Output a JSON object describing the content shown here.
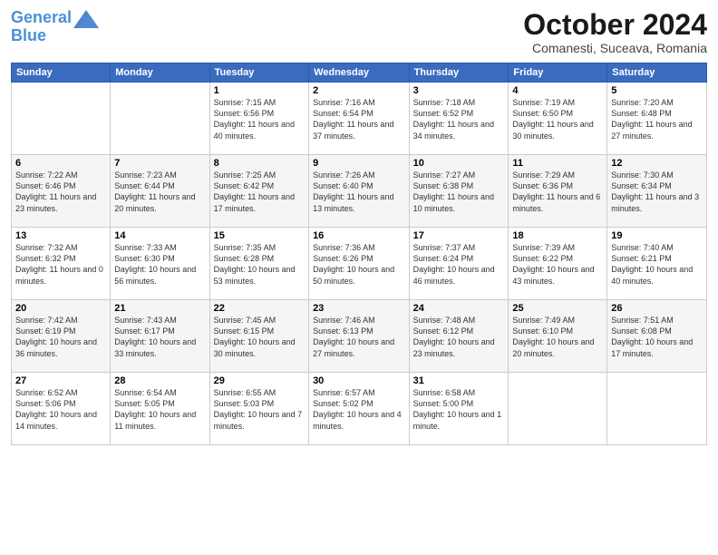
{
  "logo": {
    "line1": "General",
    "line2": "Blue"
  },
  "title": "October 2024",
  "subtitle": "Comanesti, Suceava, Romania",
  "weekdays": [
    "Sunday",
    "Monday",
    "Tuesday",
    "Wednesday",
    "Thursday",
    "Friday",
    "Saturday"
  ],
  "weeks": [
    [
      {
        "day": "",
        "detail": ""
      },
      {
        "day": "",
        "detail": ""
      },
      {
        "day": "1",
        "detail": "Sunrise: 7:15 AM\nSunset: 6:56 PM\nDaylight: 11 hours\nand 40 minutes."
      },
      {
        "day": "2",
        "detail": "Sunrise: 7:16 AM\nSunset: 6:54 PM\nDaylight: 11 hours\nand 37 minutes."
      },
      {
        "day": "3",
        "detail": "Sunrise: 7:18 AM\nSunset: 6:52 PM\nDaylight: 11 hours\nand 34 minutes."
      },
      {
        "day": "4",
        "detail": "Sunrise: 7:19 AM\nSunset: 6:50 PM\nDaylight: 11 hours\nand 30 minutes."
      },
      {
        "day": "5",
        "detail": "Sunrise: 7:20 AM\nSunset: 6:48 PM\nDaylight: 11 hours\nand 27 minutes."
      }
    ],
    [
      {
        "day": "6",
        "detail": "Sunrise: 7:22 AM\nSunset: 6:46 PM\nDaylight: 11 hours\nand 23 minutes."
      },
      {
        "day": "7",
        "detail": "Sunrise: 7:23 AM\nSunset: 6:44 PM\nDaylight: 11 hours\nand 20 minutes."
      },
      {
        "day": "8",
        "detail": "Sunrise: 7:25 AM\nSunset: 6:42 PM\nDaylight: 11 hours\nand 17 minutes."
      },
      {
        "day": "9",
        "detail": "Sunrise: 7:26 AM\nSunset: 6:40 PM\nDaylight: 11 hours\nand 13 minutes."
      },
      {
        "day": "10",
        "detail": "Sunrise: 7:27 AM\nSunset: 6:38 PM\nDaylight: 11 hours\nand 10 minutes."
      },
      {
        "day": "11",
        "detail": "Sunrise: 7:29 AM\nSunset: 6:36 PM\nDaylight: 11 hours\nand 6 minutes."
      },
      {
        "day": "12",
        "detail": "Sunrise: 7:30 AM\nSunset: 6:34 PM\nDaylight: 11 hours\nand 3 minutes."
      }
    ],
    [
      {
        "day": "13",
        "detail": "Sunrise: 7:32 AM\nSunset: 6:32 PM\nDaylight: 11 hours\nand 0 minutes."
      },
      {
        "day": "14",
        "detail": "Sunrise: 7:33 AM\nSunset: 6:30 PM\nDaylight: 10 hours\nand 56 minutes."
      },
      {
        "day": "15",
        "detail": "Sunrise: 7:35 AM\nSunset: 6:28 PM\nDaylight: 10 hours\nand 53 minutes."
      },
      {
        "day": "16",
        "detail": "Sunrise: 7:36 AM\nSunset: 6:26 PM\nDaylight: 10 hours\nand 50 minutes."
      },
      {
        "day": "17",
        "detail": "Sunrise: 7:37 AM\nSunset: 6:24 PM\nDaylight: 10 hours\nand 46 minutes."
      },
      {
        "day": "18",
        "detail": "Sunrise: 7:39 AM\nSunset: 6:22 PM\nDaylight: 10 hours\nand 43 minutes."
      },
      {
        "day": "19",
        "detail": "Sunrise: 7:40 AM\nSunset: 6:21 PM\nDaylight: 10 hours\nand 40 minutes."
      }
    ],
    [
      {
        "day": "20",
        "detail": "Sunrise: 7:42 AM\nSunset: 6:19 PM\nDaylight: 10 hours\nand 36 minutes."
      },
      {
        "day": "21",
        "detail": "Sunrise: 7:43 AM\nSunset: 6:17 PM\nDaylight: 10 hours\nand 33 minutes."
      },
      {
        "day": "22",
        "detail": "Sunrise: 7:45 AM\nSunset: 6:15 PM\nDaylight: 10 hours\nand 30 minutes."
      },
      {
        "day": "23",
        "detail": "Sunrise: 7:46 AM\nSunset: 6:13 PM\nDaylight: 10 hours\nand 27 minutes."
      },
      {
        "day": "24",
        "detail": "Sunrise: 7:48 AM\nSunset: 6:12 PM\nDaylight: 10 hours\nand 23 minutes."
      },
      {
        "day": "25",
        "detail": "Sunrise: 7:49 AM\nSunset: 6:10 PM\nDaylight: 10 hours\nand 20 minutes."
      },
      {
        "day": "26",
        "detail": "Sunrise: 7:51 AM\nSunset: 6:08 PM\nDaylight: 10 hours\nand 17 minutes."
      }
    ],
    [
      {
        "day": "27",
        "detail": "Sunrise: 6:52 AM\nSunset: 5:06 PM\nDaylight: 10 hours\nand 14 minutes."
      },
      {
        "day": "28",
        "detail": "Sunrise: 6:54 AM\nSunset: 5:05 PM\nDaylight: 10 hours\nand 11 minutes."
      },
      {
        "day": "29",
        "detail": "Sunrise: 6:55 AM\nSunset: 5:03 PM\nDaylight: 10 hours\nand 7 minutes."
      },
      {
        "day": "30",
        "detail": "Sunrise: 6:57 AM\nSunset: 5:02 PM\nDaylight: 10 hours\nand 4 minutes."
      },
      {
        "day": "31",
        "detail": "Sunrise: 6:58 AM\nSunset: 5:00 PM\nDaylight: 10 hours\nand 1 minute."
      },
      {
        "day": "",
        "detail": ""
      },
      {
        "day": "",
        "detail": ""
      }
    ]
  ]
}
